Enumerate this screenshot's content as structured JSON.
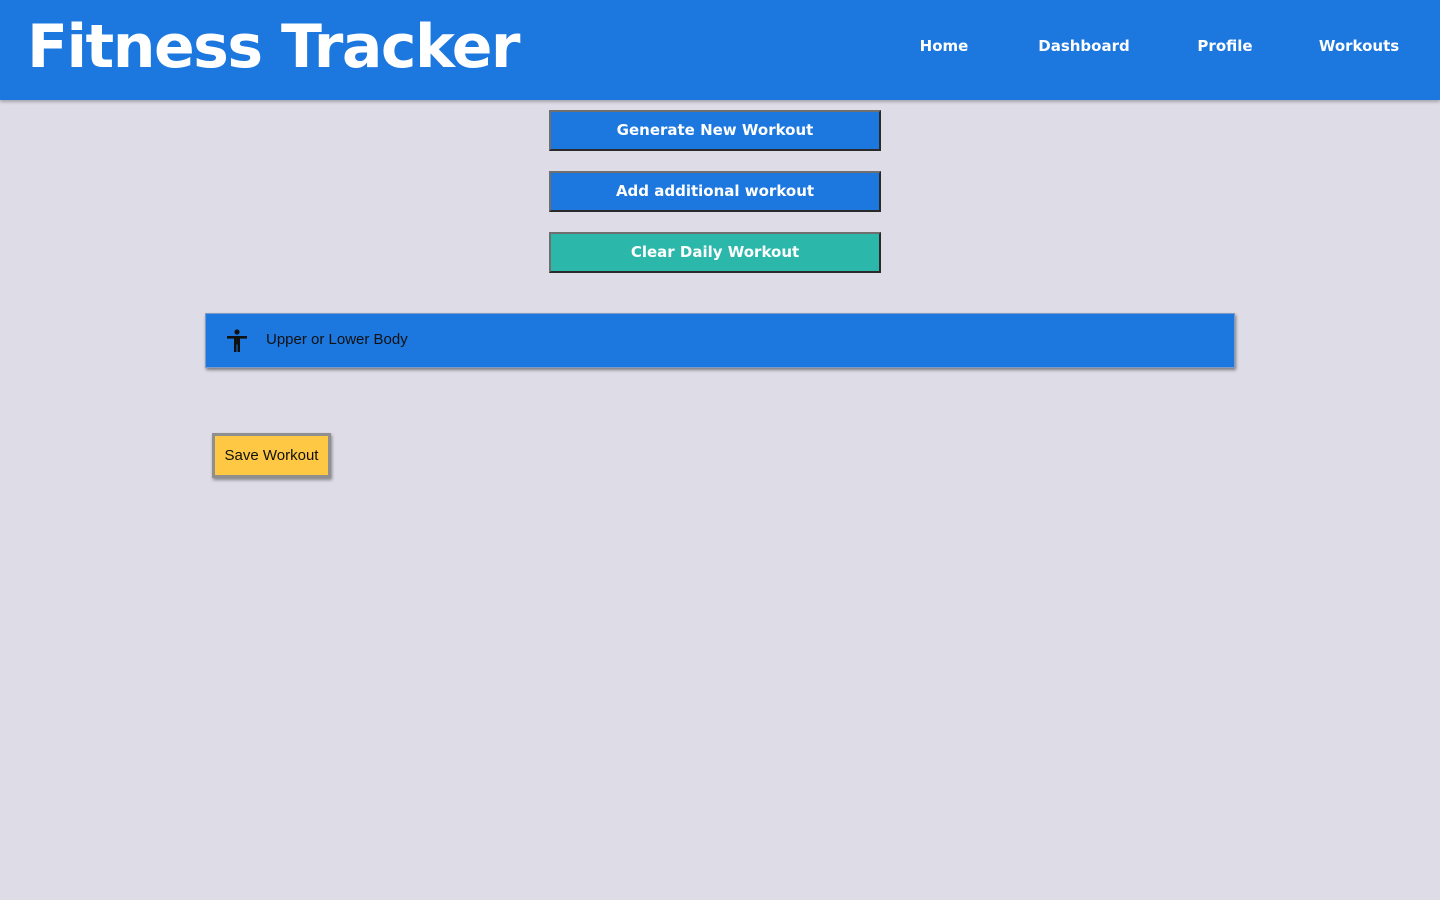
{
  "header": {
    "title": "Fitness Tracker",
    "nav": {
      "home": "Home",
      "dashboard": "Dashboard",
      "profile": "Profile",
      "workouts": "Workouts"
    }
  },
  "actions": {
    "generate_label": "Generate New Workout",
    "add_label": "Add additional workout",
    "clear_label": "Clear Daily Workout"
  },
  "workout": {
    "icon": "accessibility-icon",
    "label": "Upper or Lower Body"
  },
  "save": {
    "label": "Save Workout"
  },
  "colors": {
    "primary": "#1c77de",
    "teal": "#2bb8aa",
    "yellow": "#fec744",
    "background": "#dedce6"
  }
}
